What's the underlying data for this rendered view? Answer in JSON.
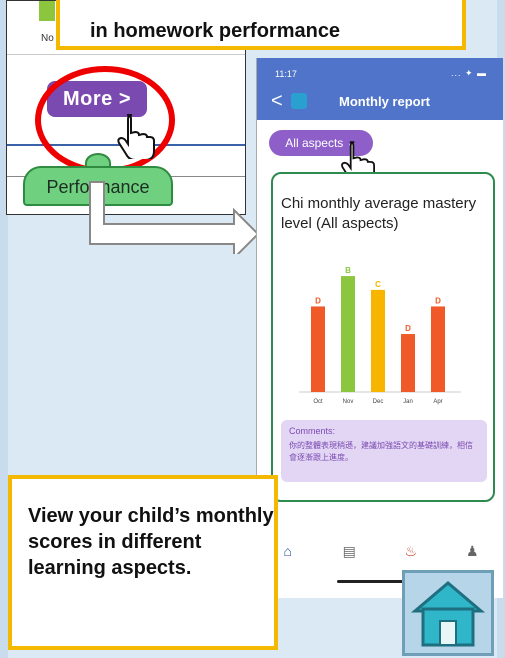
{
  "captions": {
    "top": "in homework performance",
    "bottom": "View your child’s monthly scores in different learning aspects."
  },
  "inset": {
    "label_fragment": "No",
    "more_button": "More >",
    "performance_tab": "Performance"
  },
  "phone": {
    "status_time": "11:17",
    "status_icons": "... ✦ ▬",
    "back_icon": "<",
    "title": "Monthly report",
    "aspects_dropdown": "All aspects ⌄",
    "card_title": "Chi monthly average mastery level (All aspects)",
    "comments_label": "Comments:",
    "comments_text": "你的整體表現稍遜，建議加強語文的基礎訓練，相信會逐漸跟上進度。",
    "nav": [
      "home-icon",
      "list-icon",
      "bell-icon",
      "person-icon"
    ]
  },
  "chart_data": {
    "type": "bar",
    "categories": [
      "Oct",
      "Nov",
      "Dec",
      "Jan",
      "Apr"
    ],
    "grades": [
      "D",
      "B",
      "C",
      "D",
      "D"
    ],
    "values": [
      62,
      84,
      74,
      42,
      62
    ],
    "colors": [
      "#f05a28",
      "#8cc63f",
      "#f7b500",
      "#f05a28",
      "#f05a28"
    ],
    "grade_colors": [
      "#f05a28",
      "#8cc63f",
      "#f7b500",
      "#f05a28",
      "#f05a28"
    ],
    "ylim": [
      0,
      100
    ],
    "xlabel": "",
    "ylabel": "",
    "title": ""
  },
  "colors": {
    "accent": "#4f74c9",
    "purple": "#8e5fc9",
    "caption_border": "#f5b800",
    "red_ring": "#e00000",
    "green_tab": "#6fd07f"
  }
}
